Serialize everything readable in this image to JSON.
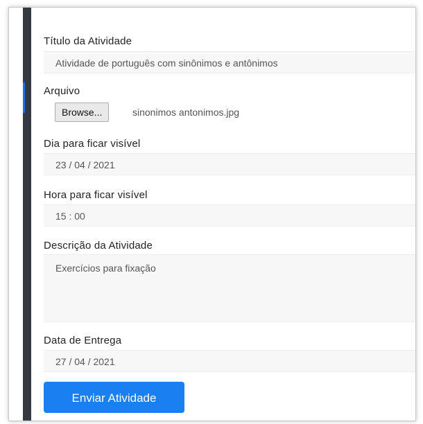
{
  "form": {
    "title": {
      "label": "Título da Atividade",
      "value": "Atividade de português com sinônimos e antônimos"
    },
    "file": {
      "label": "Arquivo",
      "browse_label": "Browse...",
      "file_name": "sinonimos antonimos.jpg"
    },
    "visible_date": {
      "label": "Dia para ficar visível",
      "value": "23 / 04 / 2021"
    },
    "visible_time": {
      "label": "Hora para ficar visível",
      "value": "15 : 00"
    },
    "description": {
      "label": "Descrição da Atividade",
      "value": "Exercícios para fixação"
    },
    "due_date": {
      "label": "Data de Entrega",
      "value": "27 / 04 / 2021"
    },
    "submit_label": "Enviar Atividade"
  },
  "colors": {
    "sidebar": "#343a40",
    "accent": "#1a7ff0",
    "field_background": "#f7f7f7"
  }
}
